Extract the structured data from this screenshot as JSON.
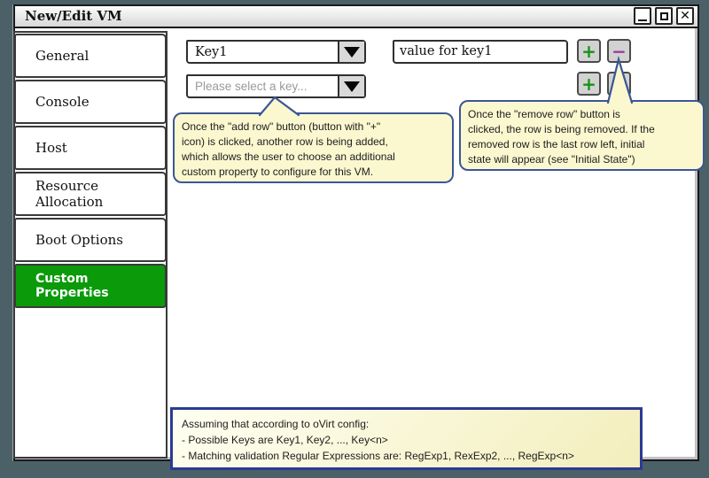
{
  "window": {
    "title": "New/Edit VM"
  },
  "icons": {
    "minimize": "_",
    "maximize": "□",
    "close": "✕",
    "dropdown_arrow": "▼",
    "add": "+",
    "remove": "−"
  },
  "colors": {
    "desktop_bg": "#4c6068",
    "selected_tab_green": "#0a9a0a",
    "add_icon_green": "#149414",
    "remove_icon_purple": "#9c399c",
    "callout_bg": "#fbf8d0",
    "callout_border": "#3a5795",
    "note_border": "#2b3a94"
  },
  "sidebar": {
    "tabs": [
      {
        "label": "General",
        "selected": false
      },
      {
        "label": "Console",
        "selected": false
      },
      {
        "label": "Host",
        "selected": false
      },
      {
        "label": "Resource Allocation",
        "selected": false
      },
      {
        "label": "Boot Options",
        "selected": false
      },
      {
        "label": "Custom Properties",
        "selected": true
      }
    ]
  },
  "properties_editor": {
    "rows": [
      {
        "key": "Key1",
        "value": "value for key1"
      },
      {
        "key_placeholder": "Please select a key..."
      }
    ]
  },
  "callouts": {
    "add_row": "Once the \"add row\" button (button with \"+\"\nicon) is clicked, another row is being added,\nwhich allows the user to choose an additional\ncustom property to configure for this VM.",
    "remove_row": "Once the \"remove row\" button is\nclicked, the row is being removed. If the\nremoved row is the last row left, initial\nstate will appear (see \"Initial State\")"
  },
  "note": "Assuming that according to oVirt config:\n- Possible Keys are Key1, Key2, ..., Key<n>\n- Matching validation Regular Expressions are: RegExp1, RexExp2, ..., RegExp<n>"
}
